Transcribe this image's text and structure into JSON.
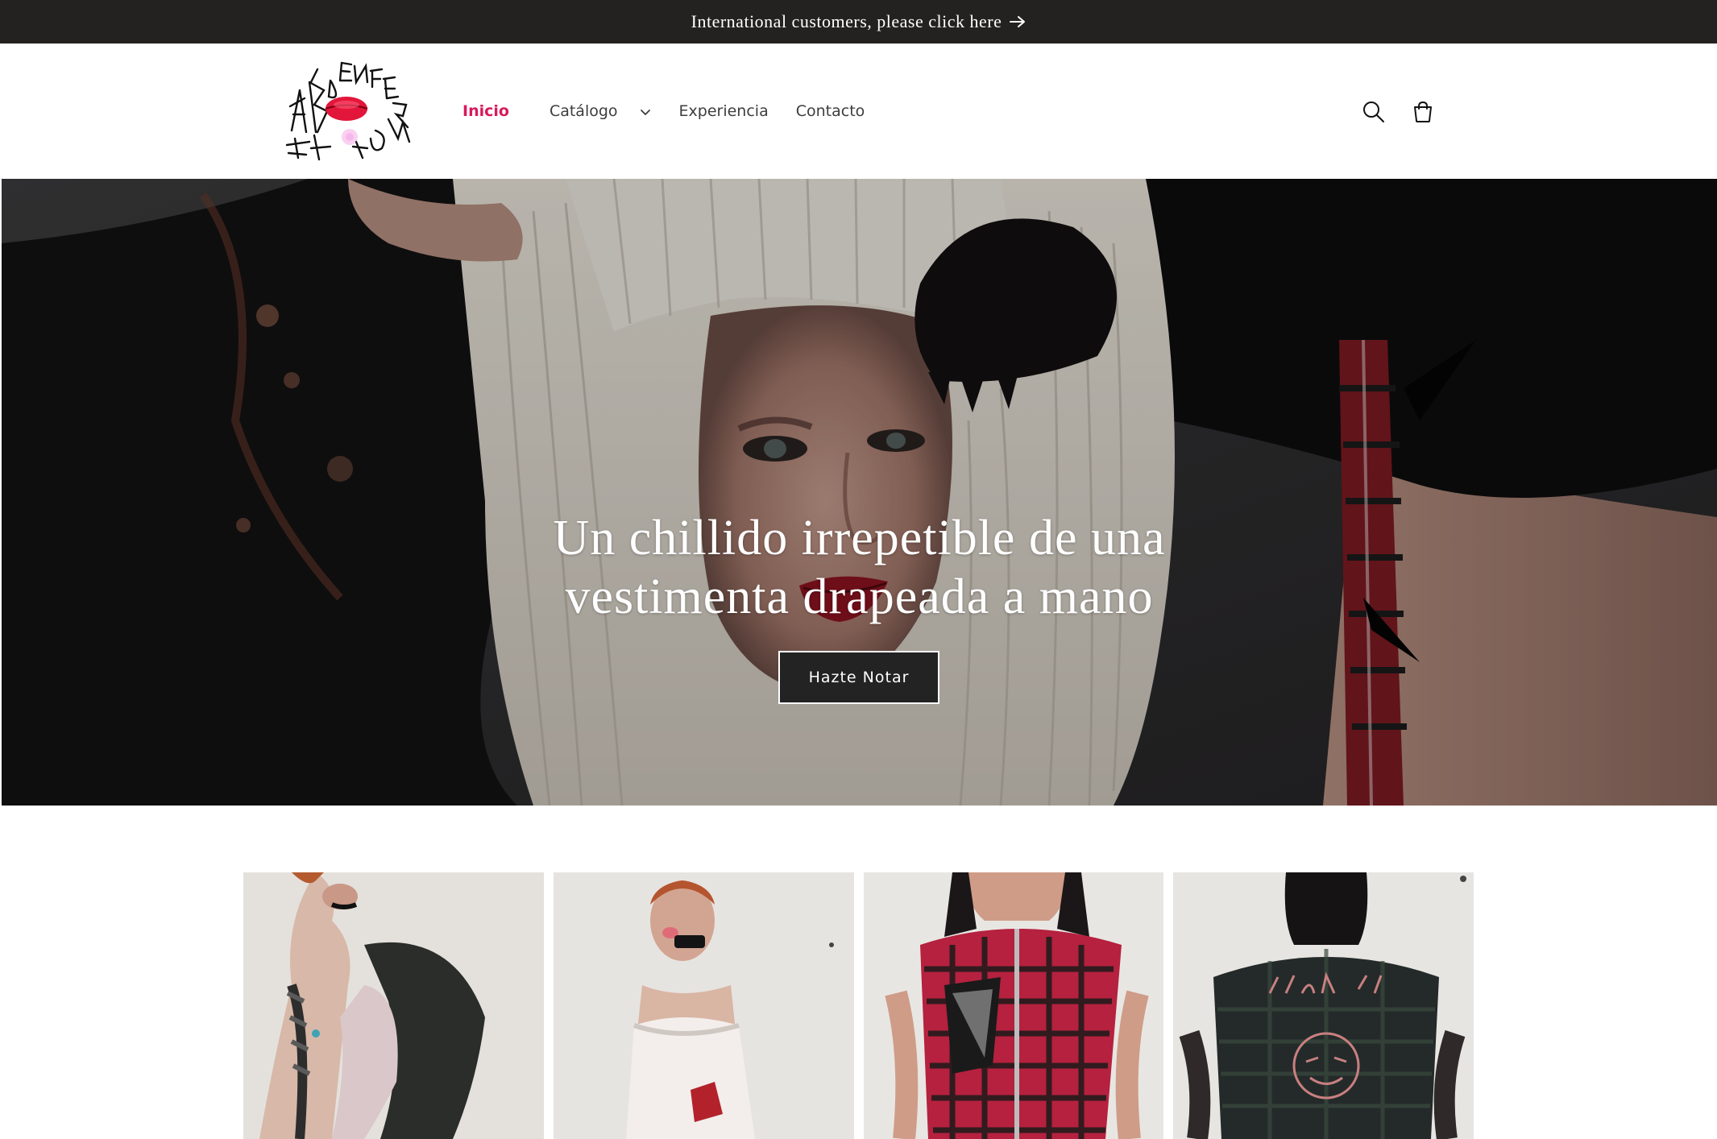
{
  "announcement": {
    "text": "International customers, please click here",
    "arrow_icon": "arrow-right-icon"
  },
  "header": {
    "logo_alt": "Labios Enfermos logo",
    "nav": [
      {
        "label": "Inicio",
        "active": true
      },
      {
        "label": "Catálogo",
        "active": false,
        "has_dropdown": true
      },
      {
        "label": "Experiencia",
        "active": false
      },
      {
        "label": "Contacto",
        "active": false
      }
    ],
    "icons": [
      "search-icon",
      "cart-icon"
    ]
  },
  "hero": {
    "heading_line1": "Un chillido irrepetible de una",
    "heading_line2": "vestimenta drapeada a mano",
    "button_label": "Hazte Notar"
  },
  "products": [
    {
      "name": "product-1"
    },
    {
      "name": "product-2"
    },
    {
      "name": "product-3"
    },
    {
      "name": "product-4"
    }
  ],
  "colors": {
    "accent": "#d8195b",
    "announcement_bg": "#232220",
    "button_bg": "#232323"
  }
}
